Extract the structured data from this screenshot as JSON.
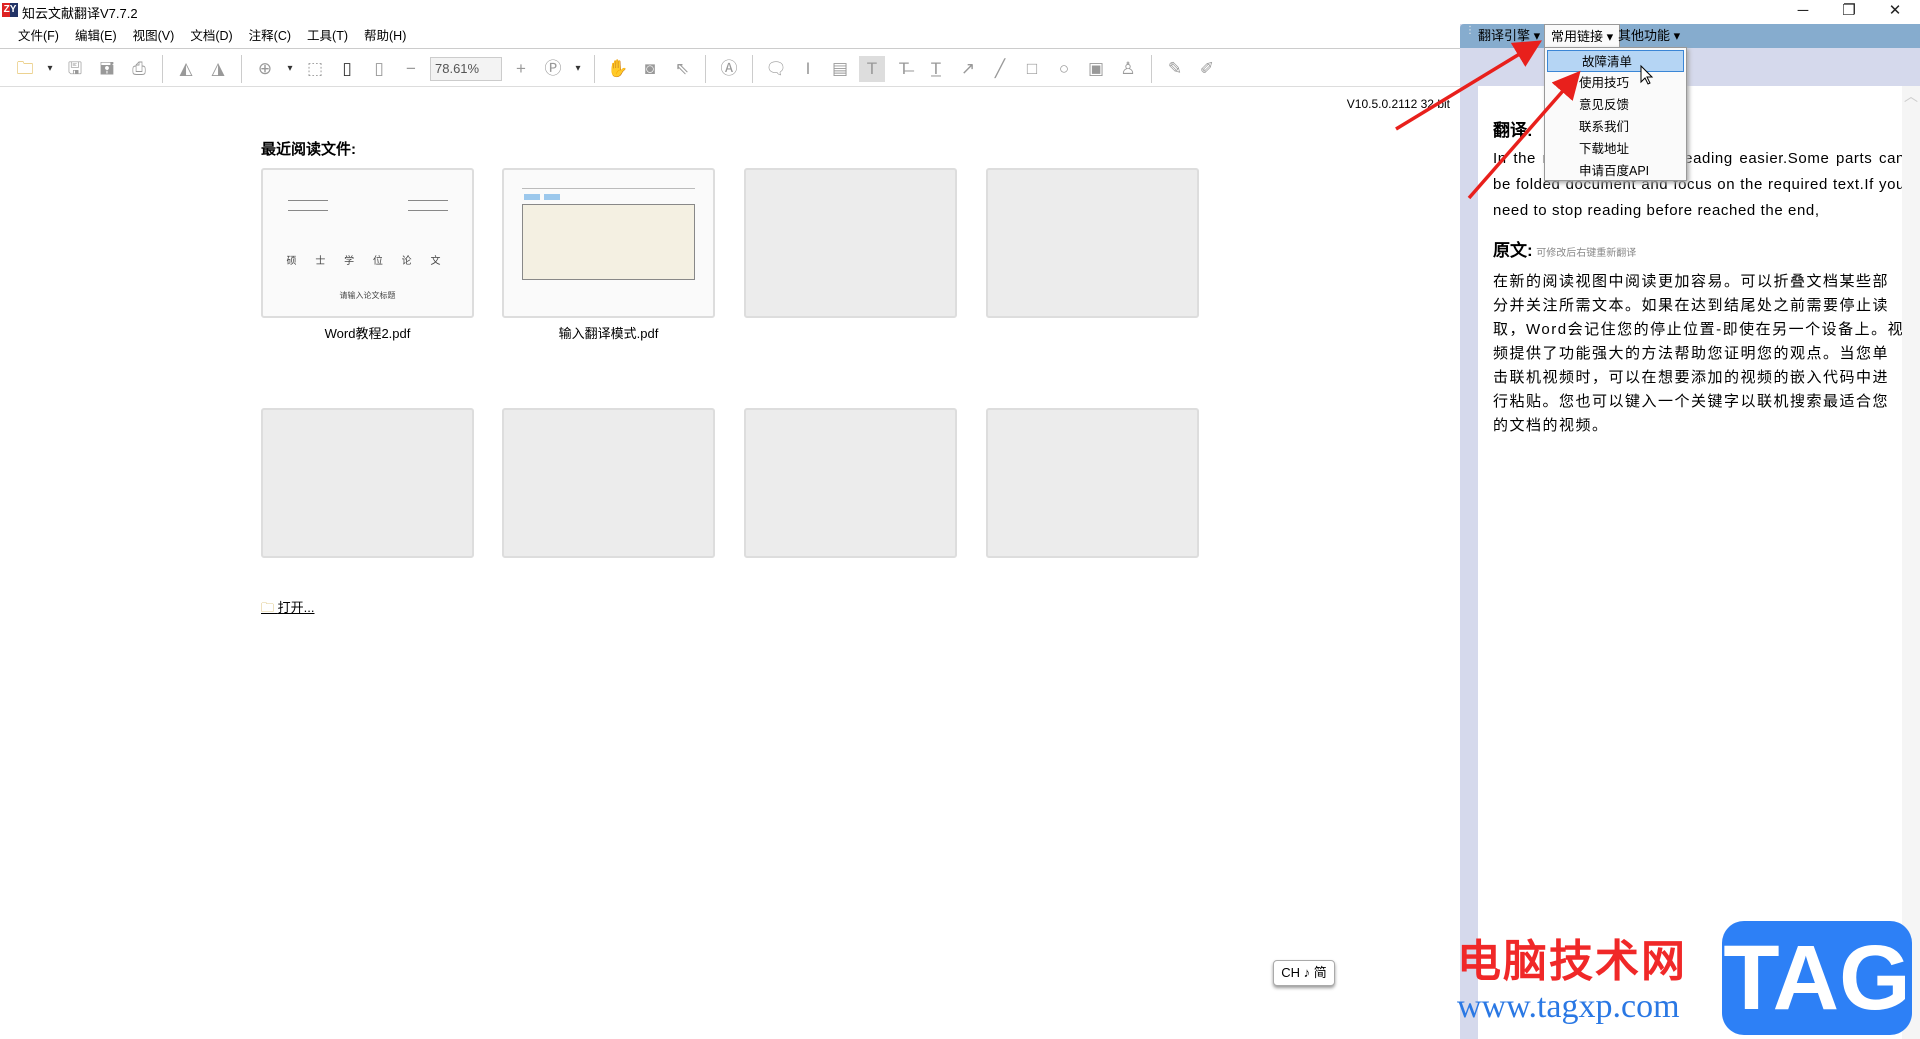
{
  "app": {
    "logo": "ZY",
    "title": "知云文献翻译V7.7.2"
  },
  "window_controls": {
    "minimize": "─",
    "restore": "❐",
    "close": "✕"
  },
  "menu": [
    "文件(F)",
    "编辑(E)",
    "视图(V)",
    "文档(D)",
    "注释(C)",
    "工具(T)",
    "帮助(H)"
  ],
  "toolbar": {
    "zoom_value": "78.61%",
    "icons": [
      "open-folder-icon",
      "save-icon",
      "save-all-icon",
      "print-icon",
      "rotate-left-icon",
      "rotate-right-icon",
      "zoom-in-icon",
      "fit-page-icon",
      "fit-height-icon",
      "fit-width-icon",
      "zoom-out-icon",
      "zoom-in-plus-icon",
      "page-icon",
      "hand-icon",
      "snapshot-icon",
      "select-icon",
      "search-text-icon",
      "comment-icon",
      "text-select-icon",
      "text-box-icon",
      "highlight-icon",
      "strikethrough-icon",
      "underline-icon",
      "arrow-icon",
      "line-icon",
      "rectangle-icon",
      "ellipse-icon",
      "image-icon",
      "stamp-icon",
      "edit-icon",
      "form-icon"
    ]
  },
  "version": "V10.5.0.2112 32 bit",
  "recent": {
    "heading": "最近阅读文件:",
    "files": [
      {
        "name": "Word教程2.pdf"
      },
      {
        "name": "输入翻译模式.pdf"
      }
    ],
    "open_link": "打开..."
  },
  "thumb1": {
    "title": "硕 士 学 位 论 文",
    "subtitle": "请输入论文标题"
  },
  "ime": "CH ♪ 简",
  "panel": {
    "menus": [
      "翻译引擎",
      "常用链接",
      "其他功能"
    ],
    "dropdown": [
      "故障清单",
      "使用技巧",
      "意见反馈",
      "联系我们",
      "下载地址",
      "申请百度API"
    ],
    "translation_heading": "翻译:",
    "translation": "In the new reading view reading easier.Some parts can be folded document and focus on the required text.If you need to stop reading before reached the end,",
    "original_heading": "原文:",
    "original_hint": "可修改后右键重新翻译",
    "original": "在新的阅读视图中阅读更加容易。可以折叠文档某些部分并关注所需文本。如果在达到结尾处之前需要停止读取，Word会记住您的停止位置-即使在另一个设备上。视频提供了功能强大的方法帮助您证明您的观点。当您单击联机视频时，可以在想要添加的视频的嵌入代码中进行粘贴。您也可以键入一个关键字以联机搜索最适合您的文档的视频。"
  },
  "watermark": {
    "cn": "电脑技术网",
    "url": "www.tagxp.com",
    "tag": "TAG"
  },
  "colors": {
    "panel_toolbar": "#86acce",
    "panel_bg": "#d5d9ec",
    "annotation_arrow": "#e8201c",
    "dropdown_highlight": "#b5d5f4"
  }
}
